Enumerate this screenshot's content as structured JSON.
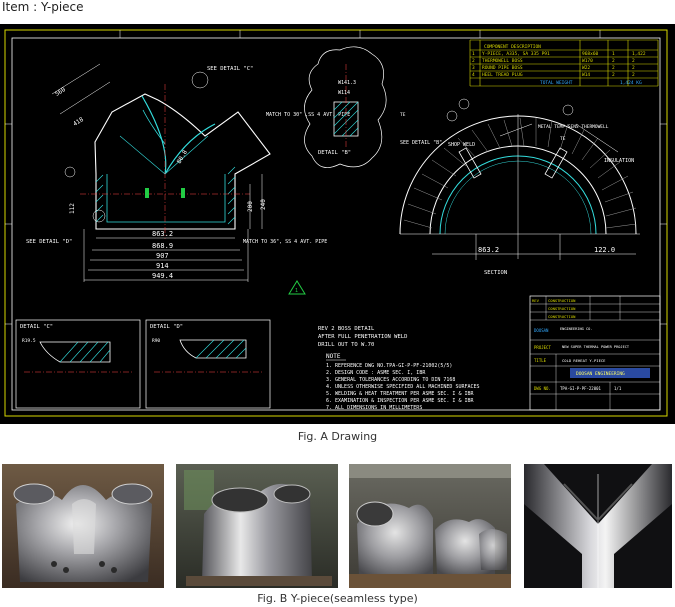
{
  "page": {
    "item_title": "Item : Y-piece",
    "fig_a_caption": "Fig. A  Drawing",
    "fig_b_caption": "Fig. B  Y-piece(seamless type)"
  },
  "drawing": {
    "see_detail_c": "SEE DETAIL \"C\"",
    "see_detail_d": "SEE DETAIL \"D\"",
    "see_detail_b": "SEE DETAIL \"B\"",
    "detail_b": "DETAIL \"B\"",
    "detail_c": "DETAIL \"C\"",
    "detail_d": "DETAIL \"D\"",
    "match_top": "MATCH TO 30\" ,SS 4 AVT. PIPE",
    "match_bottom": "MATCH TO 36\", SS 4 AVT. PIPE",
    "shop_weld": "SHOP WELD",
    "insulation": "INSULATION",
    "metal_temp": "METAL TEMP SENS THERMOWELL",
    "section": "SECTION",
    "dims": [
      "863.2",
      "868.9",
      "907",
      "914",
      "949.4",
      "122.0",
      "863.2"
    ],
    "boss_detail": [
      "REV 2  BOSS DETAIL",
      "AFTER FULL PENETRATION WELD",
      "DRILL OUT TO W.70"
    ],
    "note_heading": "NOTE",
    "notes": [
      "1. REFERENCE DWG NO.TPA-GI-P-PF-21002(5/5)",
      "2. DESIGN CODE : ASME SEC. I, IBR",
      "3. GENERAL TOLERANCES ACCORDING TO DIN 7168",
      "4. UNLESS OTHERWISE SPECIFIED ALL MACHINED SURFACES",
      "5. WELDING & HEAT TREATMENT PER ASME SEC. I & IBR",
      "6. EXAMINATION & INSPECTION PER ASME SEC. I & IBR",
      "7. ALL DIMENSIONS IN MILLIMETERS"
    ],
    "bom": [
      [
        "1",
        "Y-PIECE, A335, SA 335 P91",
        "968x60",
        "1",
        "1,422"
      ],
      [
        "2",
        "THERMOWELL BOSS",
        "W170",
        "2",
        "2"
      ],
      [
        "3",
        "ROUND PIPE BOSS",
        "W22",
        "2",
        "2"
      ],
      [
        "4",
        "HEEL TREAD PLUG",
        "W14",
        "2",
        "2"
      ]
    ],
    "bom_total": "TOTAL WEIGHT",
    "bom_total_value": "1,424 KG",
    "company": "DOOSAN ENGINEERING",
    "project": "NEW SUPER THERMAL POWER PROJECT",
    "dwg_title": "COLD REHEAT Y-PIECE",
    "dwg_no": "TPA-GI-P-PF-22001"
  }
}
